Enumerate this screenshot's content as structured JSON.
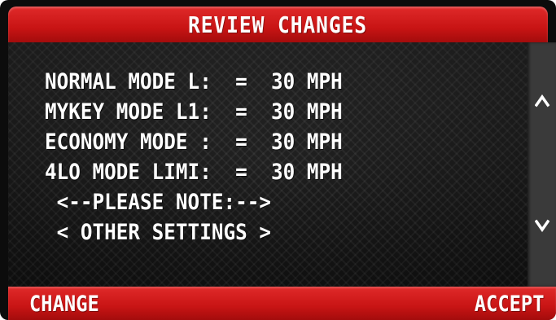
{
  "header": {
    "title": "REVIEW CHANGES"
  },
  "lines": [
    "NORMAL MODE L:  =  30 MPH",
    "MYKEY MODE L1:  =  30 MPH",
    "ECONOMY MODE :  =  30 MPH",
    "4LO MODE LIMI:  =  30 MPH",
    " <--PLEASE NOTE:-->",
    " < OTHER SETTINGS >"
  ],
  "scroll": {
    "up_icon": "arrow-up-icon",
    "down_icon": "arrow-down-icon"
  },
  "footer": {
    "left_label": "CHANGE",
    "right_label": "ACCEPT"
  },
  "colors": {
    "accent_red": "#c81414",
    "text": "#ffffff",
    "scrollbar": "#3a3a3a"
  }
}
